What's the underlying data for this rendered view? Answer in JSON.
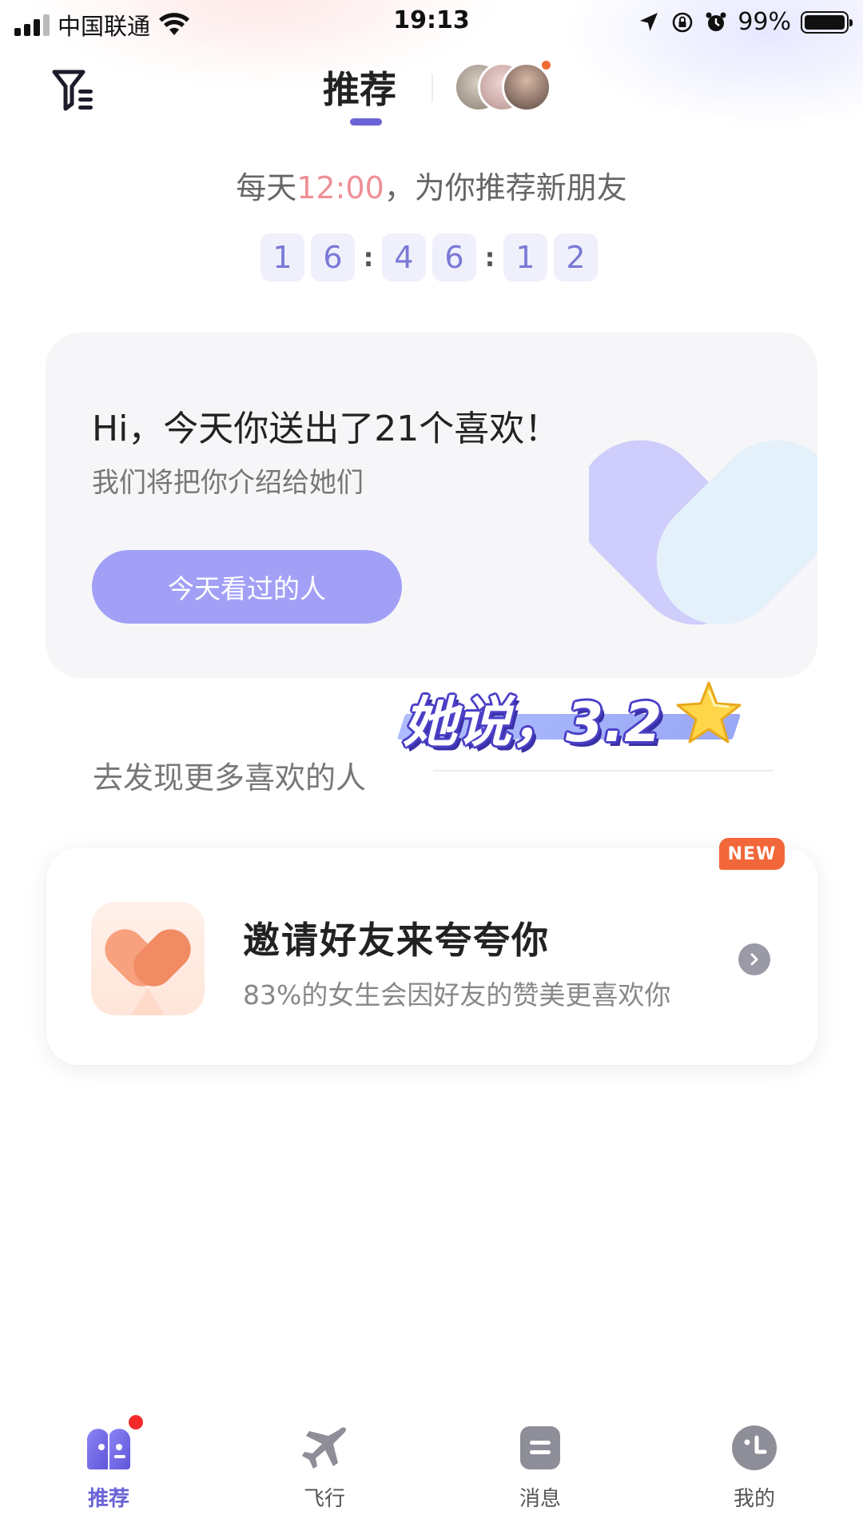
{
  "status_bar": {
    "carrier": "中国联通",
    "time": "19:13",
    "battery": "99%"
  },
  "header": {
    "tab_label": "推荐",
    "avatar_count": 3
  },
  "schedule": {
    "prefix": "每天",
    "time": "12:00",
    "suffix": "，为你推荐新朋友"
  },
  "countdown": {
    "digits": [
      "1",
      "6",
      "4",
      "6",
      "1",
      "2"
    ],
    "separator": ":"
  },
  "likes_card": {
    "title": "Hi，今天你送出了21个喜欢！",
    "subtitle": "我们将把你介绍给她们",
    "button_label": "今天看过的人"
  },
  "discover": {
    "label": "去发现更多喜欢的人",
    "banner_text": "她说，3.2"
  },
  "invite_card": {
    "badge": "NEW",
    "title": "邀请好友来夸夸你",
    "subtitle": "83%的女生会因好友的赞美更喜欢你"
  },
  "bottom_nav": [
    {
      "label": "推荐",
      "icon": "recommend-icon",
      "active": true
    },
    {
      "label": "飞行",
      "icon": "plane-icon",
      "active": false
    },
    {
      "label": "消息",
      "icon": "message-icon",
      "active": false
    },
    {
      "label": "我的",
      "icon": "profile-icon",
      "active": false
    }
  ],
  "colors": {
    "accent": "#6a63d6",
    "button": "#a2a0f6",
    "highlight_time": "#ef8f96",
    "badge": "#f2673a"
  }
}
